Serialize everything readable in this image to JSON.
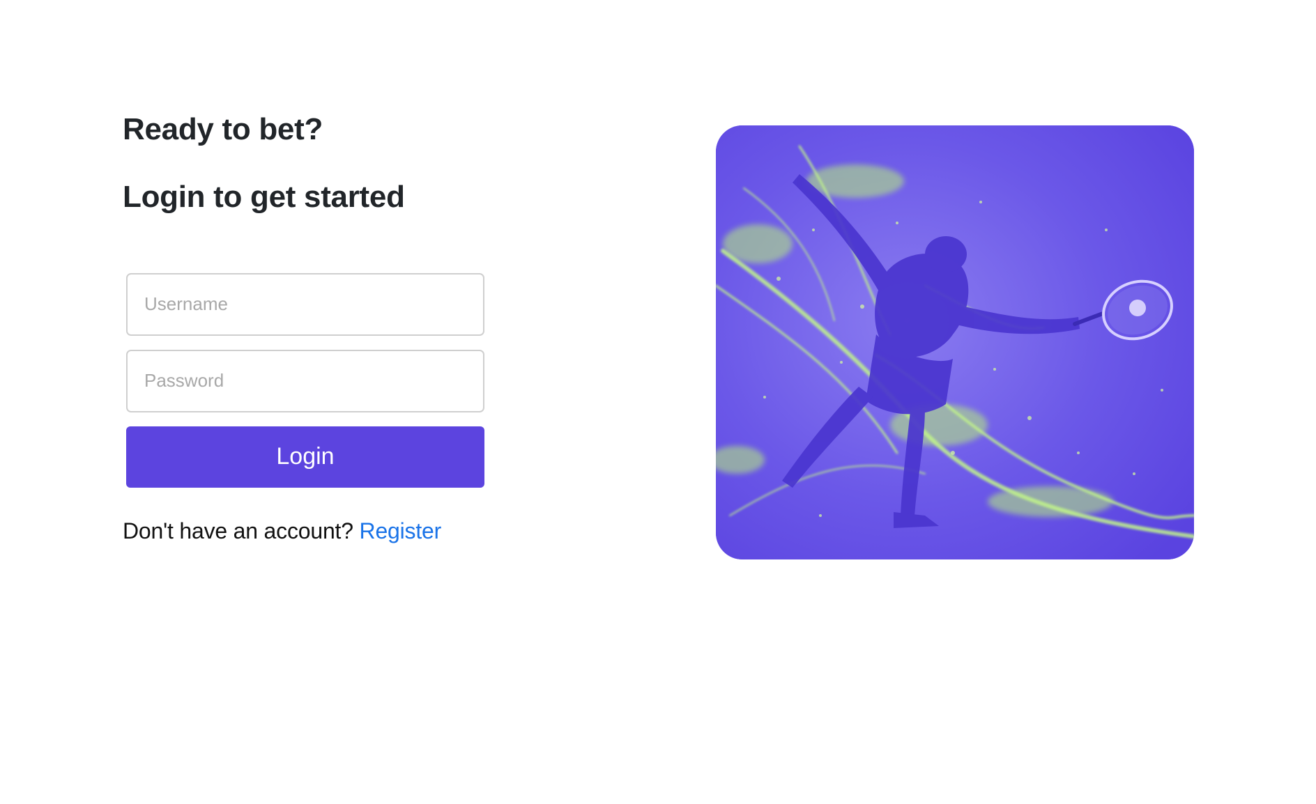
{
  "login": {
    "heading": "Ready to bet?",
    "subheading": "Login to get started",
    "username_placeholder": "Username",
    "password_placeholder": "Password",
    "submit_label": "Login",
    "register_prompt": "Don't have an account?",
    "register_link_label": "Register"
  },
  "hero_image": {
    "subject": "tennis player lunging with racket (illustration)"
  },
  "colors": {
    "accent": "#5c44df",
    "link": "#1a73e8",
    "hero_background": "#6552e6",
    "hero_highlight": "#b9f07a"
  }
}
